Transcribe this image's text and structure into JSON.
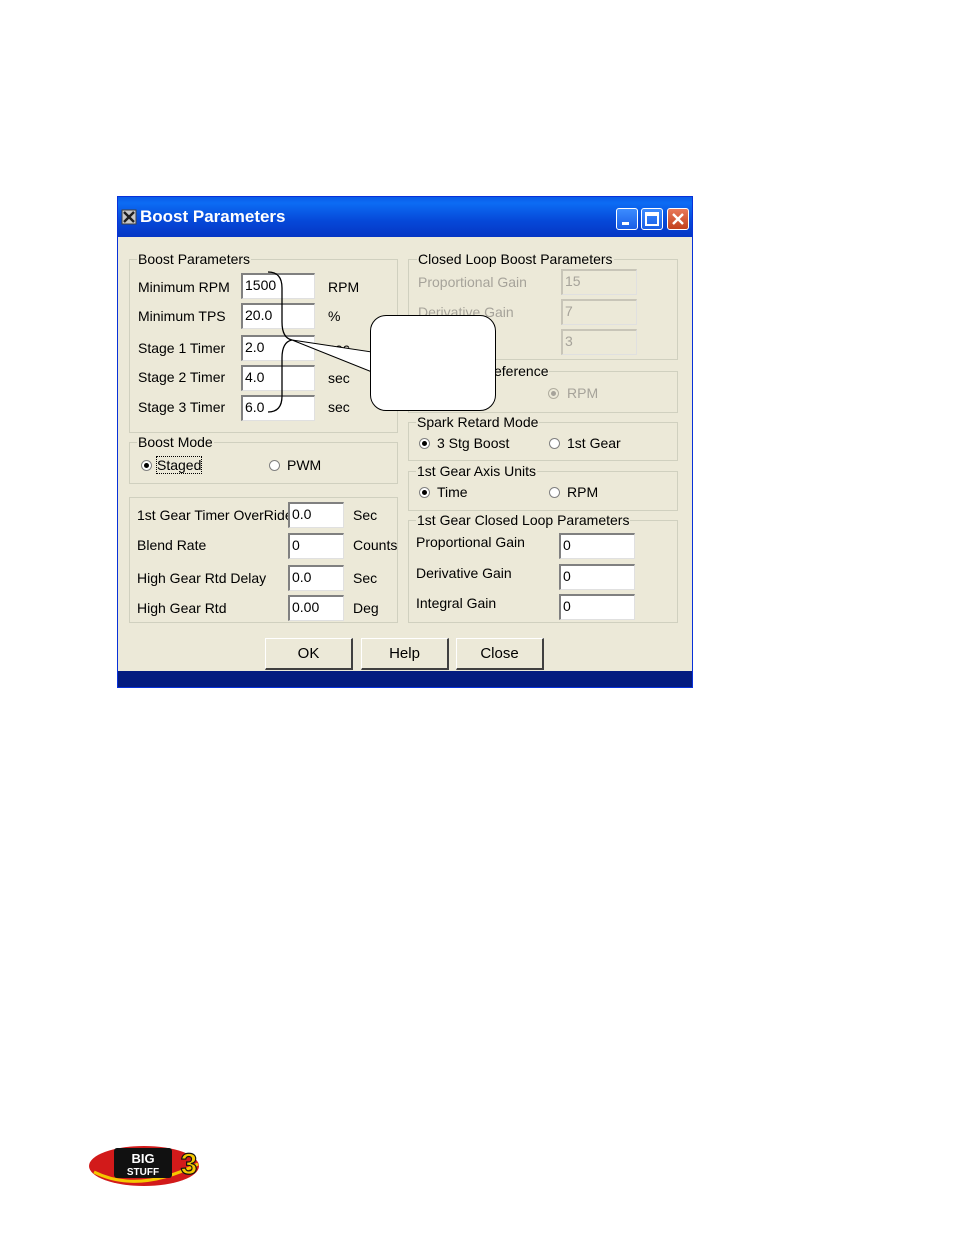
{
  "window": {
    "title": "Boost Parameters",
    "colors": {
      "titlebar": "#0648d8",
      "face": "#ece9d8",
      "close_button": "#c2401c"
    }
  },
  "boost_parameters": {
    "title": "Boost Parameters",
    "fields": [
      {
        "label": "Minimum RPM",
        "value": "1500",
        "unit": "RPM"
      },
      {
        "label": "Minimum TPS",
        "value": "20.0",
        "unit": "%"
      },
      {
        "label": "Stage 1 Timer",
        "value": "2.0",
        "unit": "sec"
      },
      {
        "label": "Stage 2 Timer",
        "value": "4.0",
        "unit": "sec"
      },
      {
        "label": "Stage 3 Timer",
        "value": "6.0",
        "unit": "sec"
      }
    ]
  },
  "boost_mode": {
    "title": "Boost Mode",
    "options": [
      {
        "label": "Staged",
        "selected": true
      },
      {
        "label": "PWM",
        "selected": false
      }
    ]
  },
  "gear_timer": {
    "fields": [
      {
        "label": "1st Gear Timer OverRide",
        "value": "0.0",
        "unit": "Sec"
      },
      {
        "label": "Blend Rate",
        "value": "0",
        "unit": "Counts"
      },
      {
        "label": "High Gear Rtd Delay",
        "value": "0.0",
        "unit": "Sec"
      },
      {
        "label": "High Gear Rtd",
        "value": "0.00",
        "unit": "Deg"
      }
    ]
  },
  "closed_loop": {
    "title": "Closed Loop Boost Parameters",
    "fields": [
      {
        "label": "Proportional Gain",
        "value": "15"
      },
      {
        "label": "Derivative Gain",
        "value": "7"
      },
      {
        "label": "",
        "value": "3"
      }
    ]
  },
  "reference": {
    "title": "eference",
    "option": "RPM"
  },
  "spark_retard": {
    "title": "Spark Retard Mode",
    "options": [
      {
        "label": "3 Stg Boost",
        "selected": true
      },
      {
        "label": "1st Gear",
        "selected": false
      }
    ]
  },
  "axis_units": {
    "title": "1st Gear Axis Units",
    "options": [
      {
        "label": "Time",
        "selected": true
      },
      {
        "label": "RPM",
        "selected": false
      }
    ]
  },
  "gear_closed_loop": {
    "title": "1st Gear Closed Loop Parameters",
    "fields": [
      {
        "label": "Proportional Gain",
        "value": "0"
      },
      {
        "label": "Derivative Gain",
        "value": "0"
      },
      {
        "label": "Integral Gain",
        "value": "0"
      }
    ]
  },
  "buttons": {
    "ok": "OK",
    "help": "Help",
    "close": "Close"
  },
  "logo": {
    "text": "BIG STUFF 3",
    "colors": {
      "red": "#d21a1a",
      "yellow": "#f5c800"
    }
  }
}
